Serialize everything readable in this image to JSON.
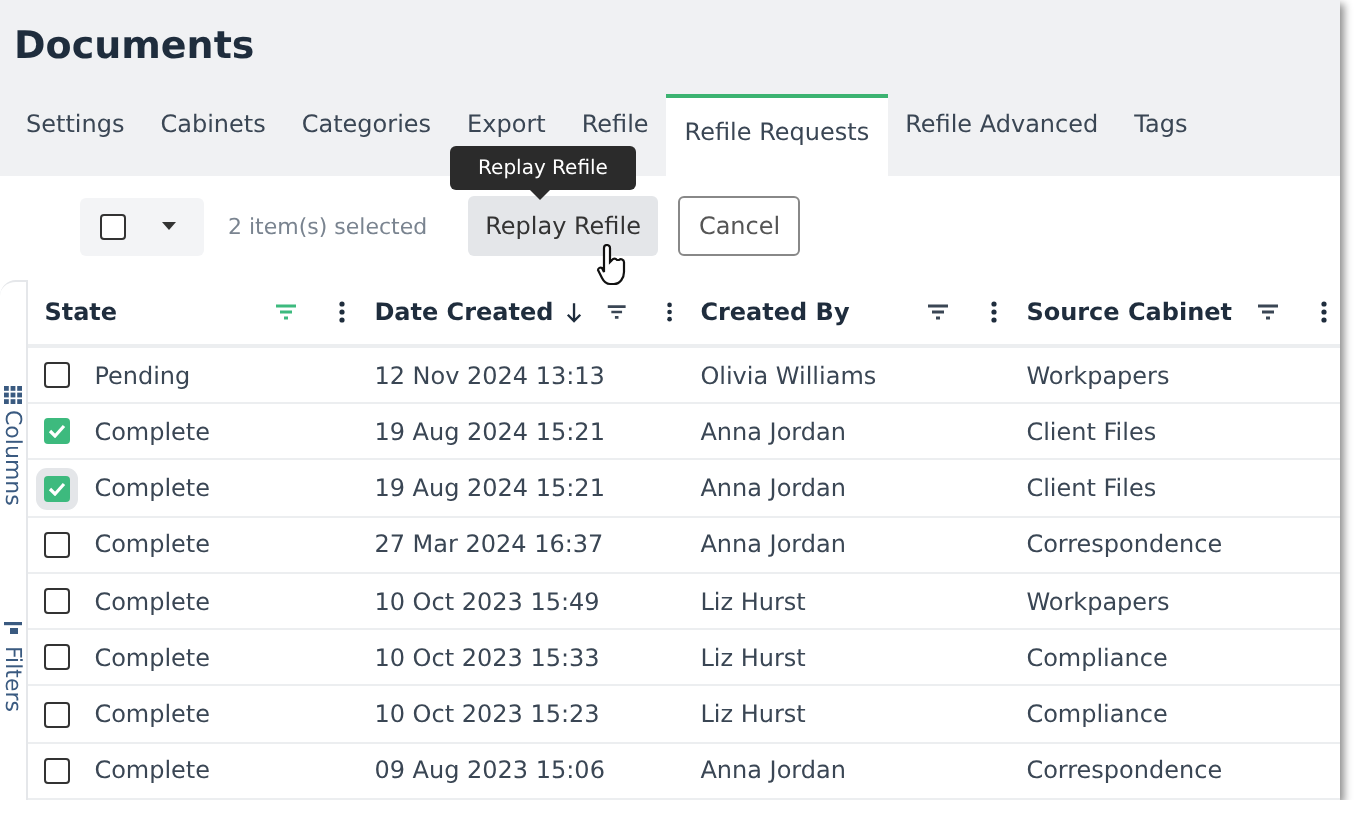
{
  "window": {
    "title": "Documents"
  },
  "tabs": [
    {
      "label": "Settings",
      "selected": false
    },
    {
      "label": "Cabinets",
      "selected": false
    },
    {
      "label": "Categories",
      "selected": false
    },
    {
      "label": "Export",
      "selected": false
    },
    {
      "label": "Refile",
      "selected": false
    },
    {
      "label": "Refile Requests",
      "selected": true
    },
    {
      "label": "Refile Advanced",
      "selected": false
    },
    {
      "label": "Tags",
      "selected": false
    }
  ],
  "tooltip": "Replay Refile",
  "toolbar": {
    "select_all_checked": false,
    "selection": "2 item(s) selected",
    "buttons": [
      {
        "label": "Replay Refile",
        "kind": "hovered"
      },
      {
        "label": "Cancel",
        "kind": "outlined"
      }
    ]
  },
  "side_panel": [
    {
      "label": "Columns",
      "kind": "columns"
    },
    {
      "label": "Filters",
      "kind": "filters"
    }
  ],
  "columns": [
    {
      "label": "State",
      "filter_active": true,
      "sorted": false
    },
    {
      "label": "Date Created",
      "filter_active": false,
      "sorted": true
    },
    {
      "label": "Created By",
      "filter_active": false,
      "sorted": false
    },
    {
      "label": "Source Cabinet",
      "filter_active": false,
      "sorted": false
    }
  ],
  "rows": [
    {
      "checked": false,
      "focused": false,
      "cells": [
        "Pending",
        "12 Nov 2024 13:13",
        "Olivia Williams",
        "Workpapers"
      ]
    },
    {
      "checked": true,
      "focused": false,
      "cells": [
        "Complete",
        "19 Aug 2024 15:21",
        "Anna Jordan",
        "Client Files"
      ]
    },
    {
      "checked": true,
      "focused": true,
      "cells": [
        "Complete",
        "19 Aug 2024 15:21",
        "Anna Jordan",
        "Client Files"
      ]
    },
    {
      "checked": false,
      "focused": false,
      "cells": [
        "Complete",
        "27 Mar 2024 16:37",
        "Anna Jordan",
        "Correspondence"
      ]
    },
    {
      "checked": false,
      "focused": false,
      "cells": [
        "Complete",
        "10 Oct 2023 15:49",
        "Liz Hurst",
        "Workpapers"
      ]
    },
    {
      "checked": false,
      "focused": false,
      "cells": [
        "Complete",
        "10 Oct 2023 15:33",
        "Liz Hurst",
        "Compliance"
      ]
    },
    {
      "checked": false,
      "focused": false,
      "cells": [
        "Complete",
        "10 Oct 2023 15:23",
        "Liz Hurst",
        "Compliance"
      ]
    },
    {
      "checked": false,
      "focused": false,
      "cells": [
        "Complete",
        "09 Aug 2023 15:06",
        "Anna Jordan",
        "Correspondence"
      ]
    }
  ]
}
